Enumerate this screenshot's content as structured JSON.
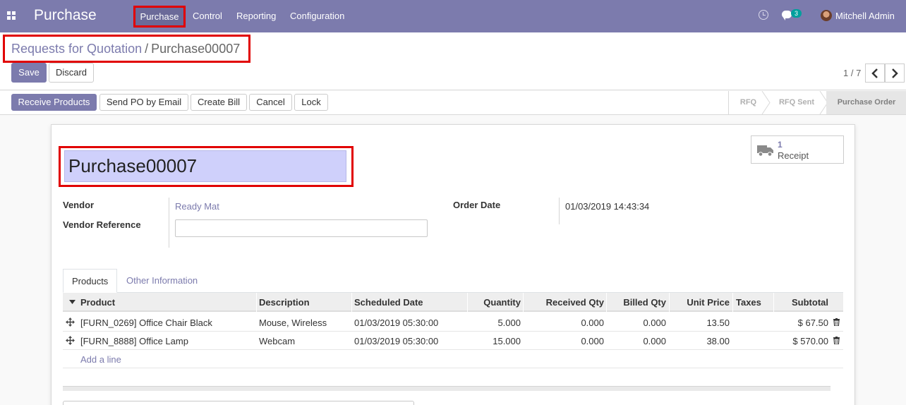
{
  "navbar": {
    "brand": "Purchase",
    "menu": [
      "Purchase",
      "Control",
      "Reporting",
      "Configuration"
    ],
    "chat_count": "3",
    "user_name": "Mitchell Admin"
  },
  "breadcrumb": {
    "parent": "Requests for Quotation",
    "separator": "/",
    "current": "Purchase00007"
  },
  "buttons": {
    "save": "Save",
    "discard": "Discard"
  },
  "pager": {
    "value": "1 / 7"
  },
  "statusbar": {
    "actions": [
      "Receive Products",
      "Send PO by Email",
      "Create Bill",
      "Cancel",
      "Lock"
    ],
    "steps": [
      "RFQ",
      "RFQ Sent",
      "Purchase Order"
    ],
    "active_step": "Purchase Order"
  },
  "smart_button": {
    "count": "1",
    "label": "Receipt"
  },
  "form": {
    "name": "Purchase00007",
    "vendor_label": "Vendor",
    "vendor_value": "Ready Mat",
    "vendor_ref_label": "Vendor Reference",
    "vendor_ref_value": "",
    "order_date_label": "Order Date",
    "order_date_value": "01/03/2019 14:43:34"
  },
  "tabs": [
    "Products",
    "Other Information"
  ],
  "table": {
    "headers": [
      "Product",
      "Description",
      "Scheduled Date",
      "Quantity",
      "Received Qty",
      "Billed Qty",
      "Unit Price",
      "Taxes",
      "Subtotal"
    ],
    "rows": [
      {
        "product": "[FURN_0269] Office Chair Black",
        "description": "Mouse, Wireless",
        "date": "01/03/2019 05:30:00",
        "qty": "5.000",
        "received": "0.000",
        "billed": "0.000",
        "price": "13.50",
        "taxes": "",
        "subtotal": "$ 67.50"
      },
      {
        "product": "[FURN_8888] Office Lamp",
        "description": "Webcam",
        "date": "01/03/2019 05:30:00",
        "qty": "15.000",
        "received": "0.000",
        "billed": "0.000",
        "price": "38.00",
        "taxes": "",
        "subtotal": "$ 570.00"
      }
    ],
    "add_line": "Add a line"
  },
  "colors": {
    "brand": "#7c7bad",
    "highlight": "#e10000",
    "name_field_bg": "#cfd0fb",
    "badge": "#00a09d"
  }
}
